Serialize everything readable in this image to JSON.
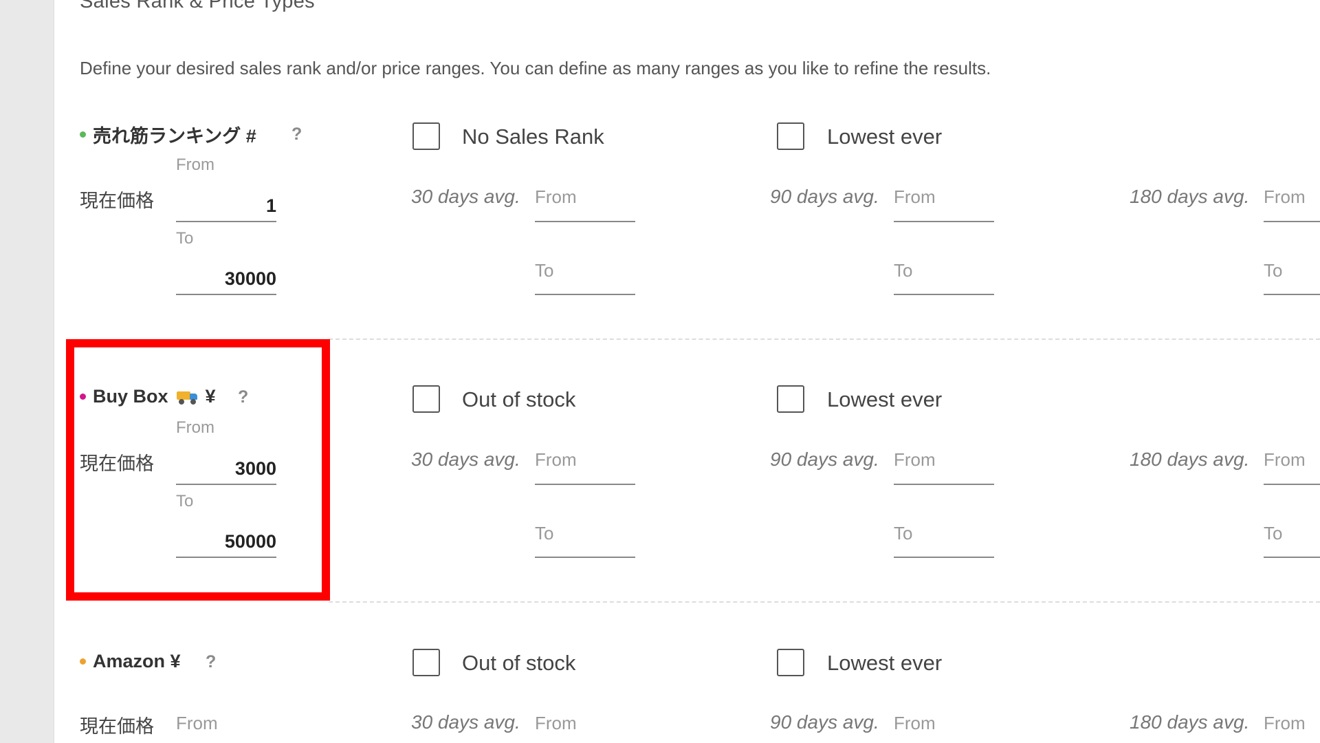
{
  "section": {
    "title": "Sales Rank & Price Types",
    "description": "Define your desired sales rank and/or price ranges. You can define as many ranges as you like to refine the results."
  },
  "common": {
    "help": "?",
    "from": "From",
    "to": "To",
    "avg30": "30 days avg.",
    "avg90": "90 days avg.",
    "avg180": "180 days avg.",
    "lowest_ever": "Lowest ever",
    "current_price": "現在価格"
  },
  "rows": [
    {
      "label": "売れ筋ランキング #",
      "dot_color": "#5cb85c",
      "check1": "No Sales Rank",
      "current_from": "1",
      "current_to": "30000"
    },
    {
      "label": "Buy Box",
      "label_suffix": "¥",
      "icon": "truck-icon",
      "dot_color": "#d4148c",
      "check1": "Out of stock",
      "current_from": "3000",
      "current_to": "50000"
    },
    {
      "label": "Amazon ¥",
      "dot_color": "#f0a030",
      "check1": "Out of stock"
    }
  ],
  "highlight_color": "#ff0000"
}
